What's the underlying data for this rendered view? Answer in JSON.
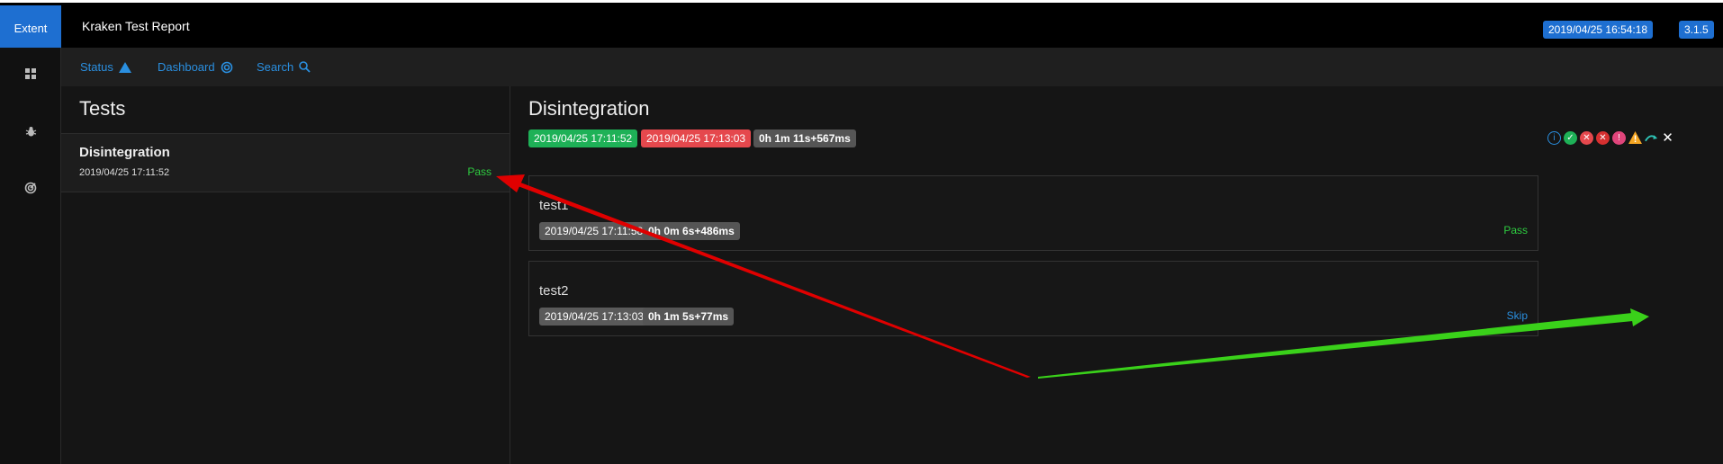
{
  "header": {
    "brand": "Extent",
    "title": "Kraken Test Report",
    "date_badge": "2019/04/25 16:54:18",
    "version_badge": "3.1.5"
  },
  "sidebar": {
    "items": [
      {
        "icon": "dashboard-icon"
      },
      {
        "icon": "bug-icon"
      },
      {
        "icon": "radar-icon"
      }
    ]
  },
  "nav": {
    "status": "Status",
    "dashboard": "Dashboard",
    "search": "Search"
  },
  "tests_pane": {
    "title": "Tests",
    "items": [
      {
        "name": "Disintegration",
        "time": "2019/04/25 17:11:52",
        "status": "Pass"
      }
    ]
  },
  "detail": {
    "title": "Disintegration",
    "start": "2019/04/25 17:11:52",
    "end": "2019/04/25 17:13:03",
    "duration": "0h 1m 11s+567ms",
    "filter_icons": [
      "info-icon",
      "pass-icon",
      "fail-icon",
      "fatal-icon",
      "error-icon",
      "warning-icon",
      "skip-icon",
      "close-icon"
    ],
    "nodes": [
      {
        "name": "test1",
        "time": "2019/04/25 17:11:58",
        "duration": "0h 0m 6s+486ms",
        "status": "Pass"
      },
      {
        "name": "test2",
        "time": "2019/04/25 17:13:03",
        "duration": "0h 1m 5s+77ms",
        "status": "Skip"
      }
    ]
  },
  "colors": {
    "accent": "#1e6fd1",
    "pass": "#2ecc40",
    "skip": "#2a8fe0",
    "fail": "#e5484d",
    "arrow_red": "#e00000",
    "arrow_green": "#3ad11a"
  }
}
